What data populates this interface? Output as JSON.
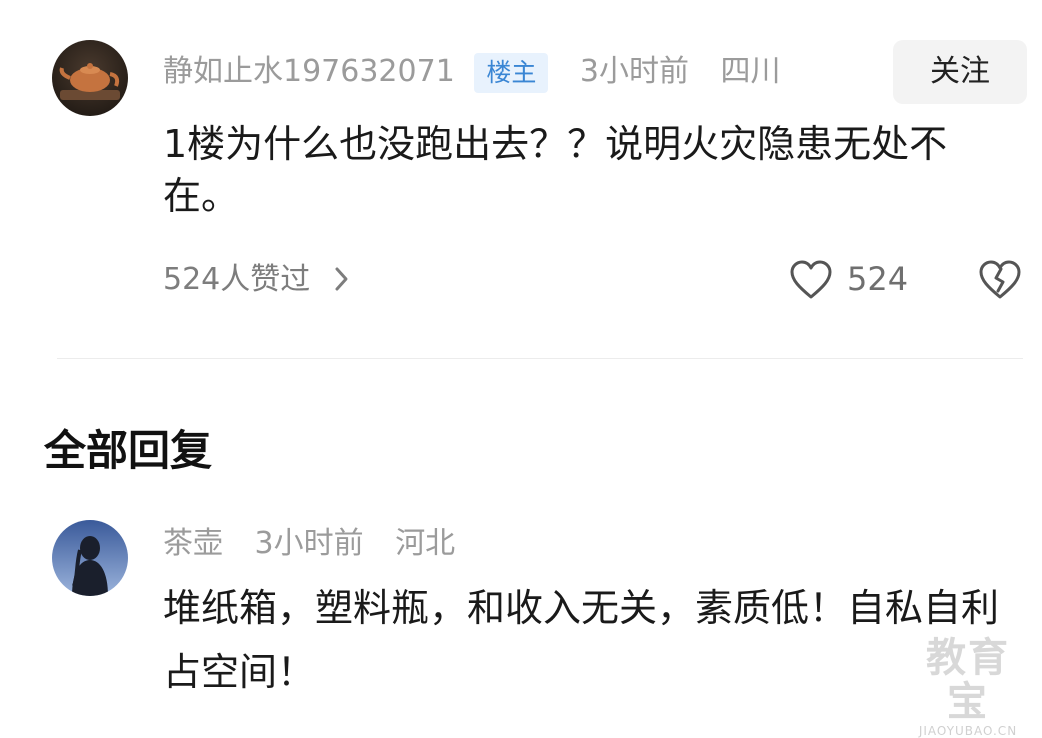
{
  "post": {
    "username": "静如止水197632071",
    "op_badge": "楼主",
    "time": "3小时前",
    "location": "四川",
    "follow_label": "关注",
    "content": "1楼为什么也没跑出去？？说明火灾隐患无处不在。",
    "likes_link": "524人赞过",
    "like_count": "524"
  },
  "replies_section": {
    "title": "全部回复"
  },
  "reply": {
    "username": "茶壶",
    "time": "3小时前",
    "location": "河北",
    "content": "堆纸箱，塑料瓶，和收入无关，素质低！自私自利占空间！"
  },
  "watermark": {
    "main": "教育宝",
    "sub": "JIAOYUBAO.CN"
  },
  "colors": {
    "badge_bg": "#e8f2fd",
    "badge_text": "#3a86d4",
    "meta_text": "#9b9b9b"
  },
  "icons": [
    "teapot-avatar",
    "heart-icon",
    "broken-heart-icon",
    "chevron-right-icon",
    "person-avatar"
  ]
}
